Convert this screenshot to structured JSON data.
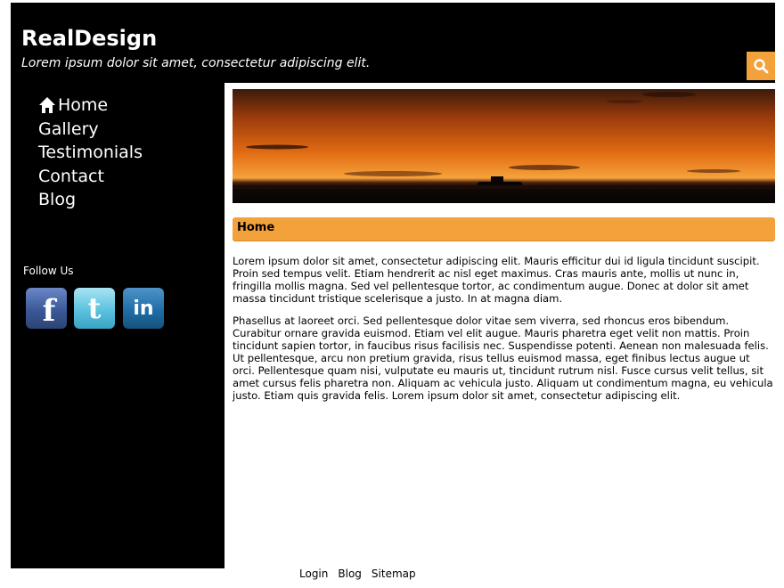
{
  "header": {
    "site_title": "RealDesign",
    "tagline": "Lorem ipsum dolor sit amet, consectetur adipiscing elit.",
    "search_icon": "search-icon",
    "accent_color": "#f3a13b"
  },
  "nav": {
    "items": [
      {
        "label": "Home",
        "icon": "home-icon"
      },
      {
        "label": "Gallery"
      },
      {
        "label": "Testimonials"
      },
      {
        "label": "Contact"
      },
      {
        "label": "Blog"
      }
    ]
  },
  "social": {
    "label": "Follow Us",
    "items": [
      {
        "icon": "facebook-icon",
        "glyph": "f"
      },
      {
        "icon": "twitter-icon",
        "glyph": "t"
      },
      {
        "icon": "linkedin-icon",
        "glyph": "in"
      }
    ]
  },
  "main": {
    "banner": "sunset-banner",
    "section_title": "Home",
    "paragraphs": [
      "Lorem ipsum dolor sit amet, consectetur adipiscing elit. Mauris efficitur dui id ligula tincidunt suscipit. Proin sed tempus velit. Etiam hendrerit ac nisl eget maximus. Cras mauris ante, mollis ut nunc in, fringilla mollis magna. Sed vel pellentesque tortor, ac condimentum augue. Donec at dolor sit amet massa tincidunt tristique scelerisque a justo. In at magna diam.",
      "Phasellus at laoreet orci. Sed pellentesque dolor vitae sem viverra, sed rhoncus eros bibendum. Curabitur ornare gravida euismod. Etiam vel elit augue. Mauris pharetra eget velit non mattis. Proin tincidunt sapien tortor, in faucibus risus facilisis nec. Suspendisse potenti. Aenean non malesuada felis. Ut pellentesque, arcu non pretium gravida, risus tellus euismod massa, eget finibus lectus augue ut orci. Pellentesque quam nisi, vulputate eu mauris ut, tincidunt rutrum nisl. Fusce cursus velit tellus, sit amet cursus felis pharetra non. Aliquam ac vehicula justo. Aliquam ut condimentum magna, eu vehicula justo. Etiam quis gravida felis. Lorem ipsum dolor sit amet, consectetur adipiscing elit."
    ]
  },
  "footer": {
    "links": [
      "Login",
      "Blog",
      "Sitemap"
    ]
  }
}
